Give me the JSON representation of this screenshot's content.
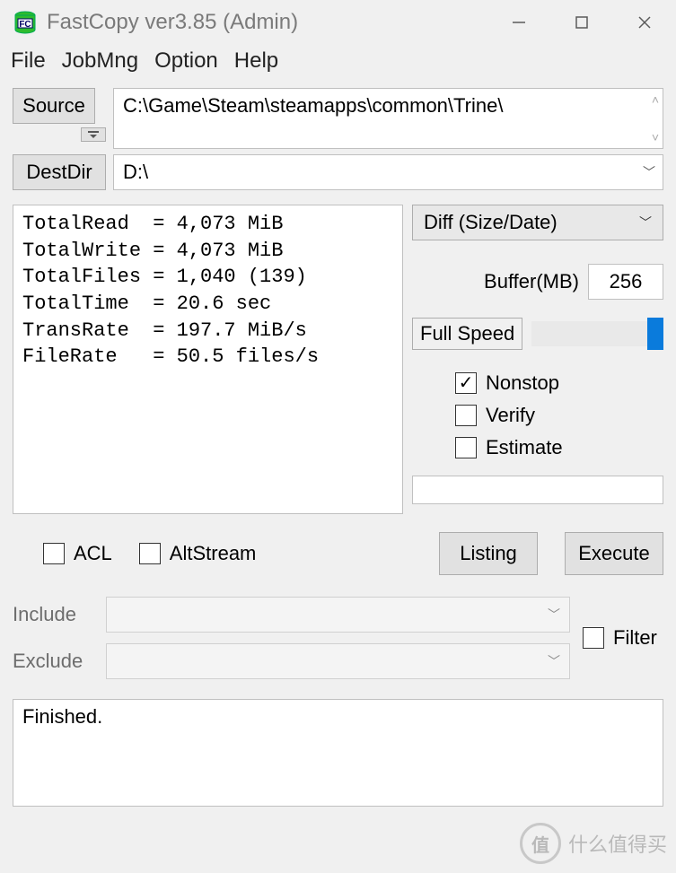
{
  "title": "FastCopy ver3.85 (Admin)",
  "menu": {
    "file": "File",
    "jobmng": "JobMng",
    "option": "Option",
    "help": "Help"
  },
  "source": {
    "button": "Source",
    "path": "C:\\Game\\Steam\\steamapps\\common\\Trine\\"
  },
  "dest": {
    "button": "DestDir",
    "path": "D:\\"
  },
  "stats_text": "TotalRead  = 4,073 MiB\nTotalWrite = 4,073 MiB\nTotalFiles = 1,040 (139)\nTotalTime  = 20.6 sec\nTransRate  = 197.7 MiB/s\nFileRate   = 50.5 files/s",
  "mode": {
    "selected": "Diff (Size/Date)"
  },
  "buffer": {
    "label": "Buffer(MB)",
    "value": "256"
  },
  "speed": {
    "label": "Full Speed"
  },
  "checks": {
    "nonstop": {
      "label": "Nonstop",
      "checked": true
    },
    "verify": {
      "label": "Verify",
      "checked": false
    },
    "estimate": {
      "label": "Estimate",
      "checked": false
    }
  },
  "bottom_checks": {
    "acl": {
      "label": "ACL",
      "checked": false
    },
    "altstream": {
      "label": "AltStream",
      "checked": false
    }
  },
  "listing_btn": "Listing",
  "execute_btn": "Execute",
  "filters": {
    "include_label": "Include",
    "exclude_label": "Exclude",
    "filter_label": "Filter",
    "filter_checked": false
  },
  "output": "Finished.",
  "watermark": {
    "badge": "值",
    "text": "什么值得买"
  }
}
